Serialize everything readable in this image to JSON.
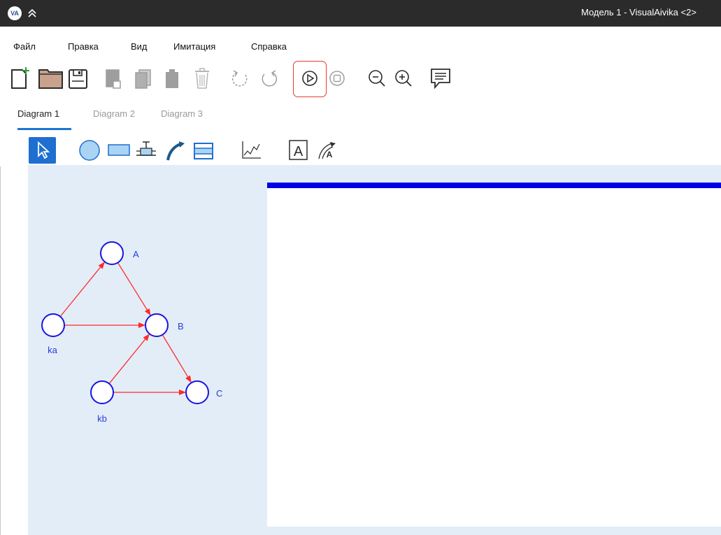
{
  "window": {
    "title": "Модель 1 - VisualAivika <2>",
    "logo_text": "VA"
  },
  "menu": {
    "items": [
      {
        "label": "Файл"
      },
      {
        "label": "Правка"
      },
      {
        "label": "Вид"
      },
      {
        "label": "Имитация"
      },
      {
        "label": "Справка"
      }
    ]
  },
  "toolbar": {
    "icons": [
      "new-file-icon",
      "open-folder-icon",
      "save-icon",
      "copy-icon",
      "duplicate-icon",
      "paste-icon",
      "delete-icon",
      "undo-icon",
      "redo-icon",
      "run-icon",
      "stop-icon",
      "zoom-out-icon",
      "zoom-in-icon",
      "comment-icon"
    ],
    "highlight_color": "#e53935"
  },
  "tabs": [
    {
      "label": "Diagram 1",
      "active": true
    },
    {
      "label": "Diagram 2",
      "active": false
    },
    {
      "label": "Diagram 3",
      "active": false
    }
  ],
  "palette": {
    "tools": [
      "pointer-tool-icon",
      "circle-node-icon",
      "rectangle-node-icon",
      "valve-icon",
      "curved-arrow-icon",
      "subdiagram-icon",
      "chart-icon",
      "text-tool-icon",
      "label-arrow-icon"
    ],
    "selected_color": "#1e6fd0"
  },
  "diagram": {
    "nodes": [
      {
        "id": "A",
        "label": "A"
      },
      {
        "id": "B",
        "label": "B"
      },
      {
        "id": "C",
        "label": "C"
      },
      {
        "id": "ka",
        "label": "ka"
      },
      {
        "id": "kb",
        "label": "kb"
      }
    ],
    "edges": [
      {
        "from": "ka",
        "to": "A"
      },
      {
        "from": "ka",
        "to": "B"
      },
      {
        "from": "A",
        "to": "B"
      },
      {
        "from": "kb",
        "to": "B"
      },
      {
        "from": "kb",
        "to": "C"
      },
      {
        "from": "B",
        "to": "C"
      }
    ],
    "node_color": "#1515e0",
    "edge_color": "#ff2a2a",
    "background": "#e3edf8"
  },
  "chart_panel": {
    "bar_color": "#0000e6"
  }
}
